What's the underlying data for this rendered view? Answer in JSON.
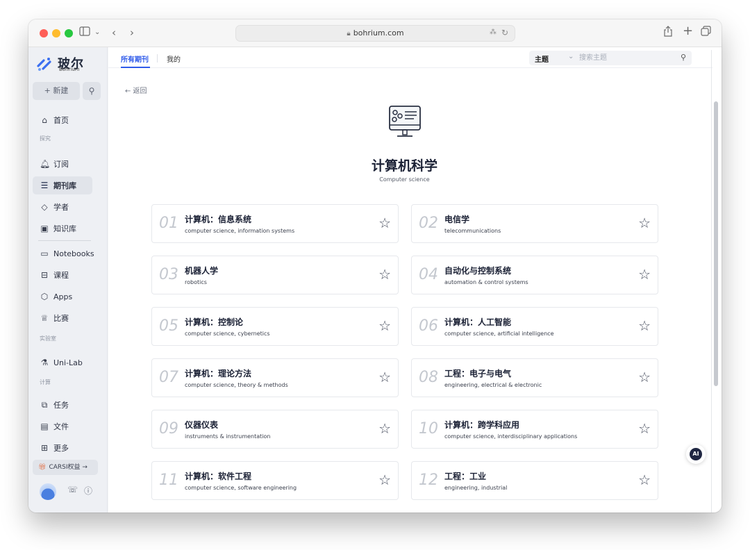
{
  "browser": {
    "url": "bohrium.com",
    "icons": [
      "sidebar-toggle-icon",
      "chevron-down-icon",
      "back-arrow-icon",
      "forward-arrow-icon",
      "lock-icon",
      "translate-icon",
      "reload-icon",
      "share-icon",
      "new-tab-icon",
      "tabs-overview-icon"
    ]
  },
  "sidebar": {
    "logo_cn": "玻尔",
    "logo_en": "Bohrium",
    "new_label": "+ 新建",
    "sections": {
      "explore": "探究",
      "lab": "实验室",
      "compute": "计算"
    },
    "items": [
      {
        "label": "首页",
        "icon": "home-icon"
      },
      {
        "label": "订阅",
        "icon": "bell-icon"
      },
      {
        "label": "期刊库",
        "icon": "journal-library-icon"
      },
      {
        "label": "学者",
        "icon": "scholar-icon"
      },
      {
        "label": "知识库",
        "icon": "knowledge-base-icon"
      },
      {
        "label": "Notebooks",
        "icon": "notebook-icon"
      },
      {
        "label": "课程",
        "icon": "course-icon"
      },
      {
        "label": "Apps",
        "icon": "apps-icon"
      },
      {
        "label": "比赛",
        "icon": "trophy-icon"
      },
      {
        "label": "Uni-Lab",
        "icon": "unilab-icon"
      },
      {
        "label": "任务",
        "icon": "task-icon"
      },
      {
        "label": "文件",
        "icon": "file-icon"
      },
      {
        "label": "更多",
        "icon": "more-grid-icon"
      }
    ],
    "cars_label": "CARSI权益 →"
  },
  "topbar": {
    "tabs": [
      "所有期刊",
      "我的"
    ],
    "filter_label": "主题",
    "search_placeholder": "搜索主题"
  },
  "back_label": "← 返回",
  "hero": {
    "title": "计算机科学",
    "subtitle": "Computer science"
  },
  "cards": [
    {
      "num": "01",
      "title": "计算机：信息系统",
      "sub": "computer science, information systems"
    },
    {
      "num": "02",
      "title": "电信学",
      "sub": "telecommunications"
    },
    {
      "num": "03",
      "title": "机器人学",
      "sub": "robotics"
    },
    {
      "num": "04",
      "title": "自动化与控制系统",
      "sub": "automation & control systems"
    },
    {
      "num": "05",
      "title": "计算机：控制论",
      "sub": "computer science, cybernetics"
    },
    {
      "num": "06",
      "title": "计算机：人工智能",
      "sub": "computer science, artificial intelligence"
    },
    {
      "num": "07",
      "title": "计算机：理论方法",
      "sub": "computer science, theory & methods"
    },
    {
      "num": "08",
      "title": "工程：电子与电气",
      "sub": "engineering, electrical & electronic"
    },
    {
      "num": "09",
      "title": "仪器仪表",
      "sub": "instruments & instrumentation"
    },
    {
      "num": "10",
      "title": "计算机：跨学科应用",
      "sub": "computer science, interdisciplinary applications"
    },
    {
      "num": "11",
      "title": "计算机：软件工程",
      "sub": "computer science, software engineering"
    },
    {
      "num": "12",
      "title": "工程：工业",
      "sub": "engineering, industrial"
    }
  ],
  "ai_label": "AI",
  "colors": {
    "accent": "#2f5bea",
    "sidebar_bg": "#eef0f4",
    "logo_blue": "#3b6ff0"
  }
}
